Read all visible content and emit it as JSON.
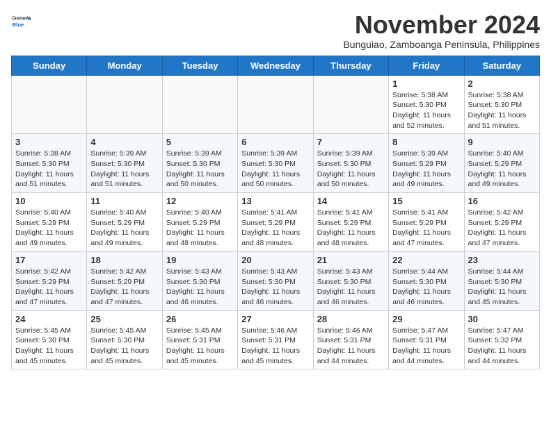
{
  "logo": {
    "general": "General",
    "blue": "Blue"
  },
  "title": "November 2024",
  "subtitle": "Bunguiao, Zamboanga Peninsula, Philippines",
  "days_header": [
    "Sunday",
    "Monday",
    "Tuesday",
    "Wednesday",
    "Thursday",
    "Friday",
    "Saturday"
  ],
  "weeks": [
    [
      {
        "day": "",
        "detail": ""
      },
      {
        "day": "",
        "detail": ""
      },
      {
        "day": "",
        "detail": ""
      },
      {
        "day": "",
        "detail": ""
      },
      {
        "day": "",
        "detail": ""
      },
      {
        "day": "1",
        "detail": "Sunrise: 5:38 AM\nSunset: 5:30 PM\nDaylight: 11 hours and 52 minutes."
      },
      {
        "day": "2",
        "detail": "Sunrise: 5:38 AM\nSunset: 5:30 PM\nDaylight: 11 hours and 51 minutes."
      }
    ],
    [
      {
        "day": "3",
        "detail": "Sunrise: 5:38 AM\nSunset: 5:30 PM\nDaylight: 11 hours and 51 minutes."
      },
      {
        "day": "4",
        "detail": "Sunrise: 5:39 AM\nSunset: 5:30 PM\nDaylight: 11 hours and 51 minutes."
      },
      {
        "day": "5",
        "detail": "Sunrise: 5:39 AM\nSunset: 5:30 PM\nDaylight: 11 hours and 50 minutes."
      },
      {
        "day": "6",
        "detail": "Sunrise: 5:39 AM\nSunset: 5:30 PM\nDaylight: 11 hours and 50 minutes."
      },
      {
        "day": "7",
        "detail": "Sunrise: 5:39 AM\nSunset: 5:30 PM\nDaylight: 11 hours and 50 minutes."
      },
      {
        "day": "8",
        "detail": "Sunrise: 5:39 AM\nSunset: 5:29 PM\nDaylight: 11 hours and 49 minutes."
      },
      {
        "day": "9",
        "detail": "Sunrise: 5:40 AM\nSunset: 5:29 PM\nDaylight: 11 hours and 49 minutes."
      }
    ],
    [
      {
        "day": "10",
        "detail": "Sunrise: 5:40 AM\nSunset: 5:29 PM\nDaylight: 11 hours and 49 minutes."
      },
      {
        "day": "11",
        "detail": "Sunrise: 5:40 AM\nSunset: 5:29 PM\nDaylight: 11 hours and 49 minutes."
      },
      {
        "day": "12",
        "detail": "Sunrise: 5:40 AM\nSunset: 5:29 PM\nDaylight: 11 hours and 48 minutes."
      },
      {
        "day": "13",
        "detail": "Sunrise: 5:41 AM\nSunset: 5:29 PM\nDaylight: 11 hours and 48 minutes."
      },
      {
        "day": "14",
        "detail": "Sunrise: 5:41 AM\nSunset: 5:29 PM\nDaylight: 11 hours and 48 minutes."
      },
      {
        "day": "15",
        "detail": "Sunrise: 5:41 AM\nSunset: 5:29 PM\nDaylight: 11 hours and 47 minutes."
      },
      {
        "day": "16",
        "detail": "Sunrise: 5:42 AM\nSunset: 5:29 PM\nDaylight: 11 hours and 47 minutes."
      }
    ],
    [
      {
        "day": "17",
        "detail": "Sunrise: 5:42 AM\nSunset: 5:29 PM\nDaylight: 11 hours and 47 minutes."
      },
      {
        "day": "18",
        "detail": "Sunrise: 5:42 AM\nSunset: 5:29 PM\nDaylight: 11 hours and 47 minutes."
      },
      {
        "day": "19",
        "detail": "Sunrise: 5:43 AM\nSunset: 5:30 PM\nDaylight: 11 hours and 46 minutes."
      },
      {
        "day": "20",
        "detail": "Sunrise: 5:43 AM\nSunset: 5:30 PM\nDaylight: 11 hours and 46 minutes."
      },
      {
        "day": "21",
        "detail": "Sunrise: 5:43 AM\nSunset: 5:30 PM\nDaylight: 11 hours and 46 minutes."
      },
      {
        "day": "22",
        "detail": "Sunrise: 5:44 AM\nSunset: 5:30 PM\nDaylight: 11 hours and 46 minutes."
      },
      {
        "day": "23",
        "detail": "Sunrise: 5:44 AM\nSunset: 5:30 PM\nDaylight: 11 hours and 45 minutes."
      }
    ],
    [
      {
        "day": "24",
        "detail": "Sunrise: 5:45 AM\nSunset: 5:30 PM\nDaylight: 11 hours and 45 minutes."
      },
      {
        "day": "25",
        "detail": "Sunrise: 5:45 AM\nSunset: 5:30 PM\nDaylight: 11 hours and 45 minutes."
      },
      {
        "day": "26",
        "detail": "Sunrise: 5:45 AM\nSunset: 5:31 PM\nDaylight: 11 hours and 45 minutes."
      },
      {
        "day": "27",
        "detail": "Sunrise: 5:46 AM\nSunset: 5:31 PM\nDaylight: 11 hours and 45 minutes."
      },
      {
        "day": "28",
        "detail": "Sunrise: 5:46 AM\nSunset: 5:31 PM\nDaylight: 11 hours and 44 minutes."
      },
      {
        "day": "29",
        "detail": "Sunrise: 5:47 AM\nSunset: 5:31 PM\nDaylight: 11 hours and 44 minutes."
      },
      {
        "day": "30",
        "detail": "Sunrise: 5:47 AM\nSunset: 5:32 PM\nDaylight: 11 hours and 44 minutes."
      }
    ]
  ]
}
